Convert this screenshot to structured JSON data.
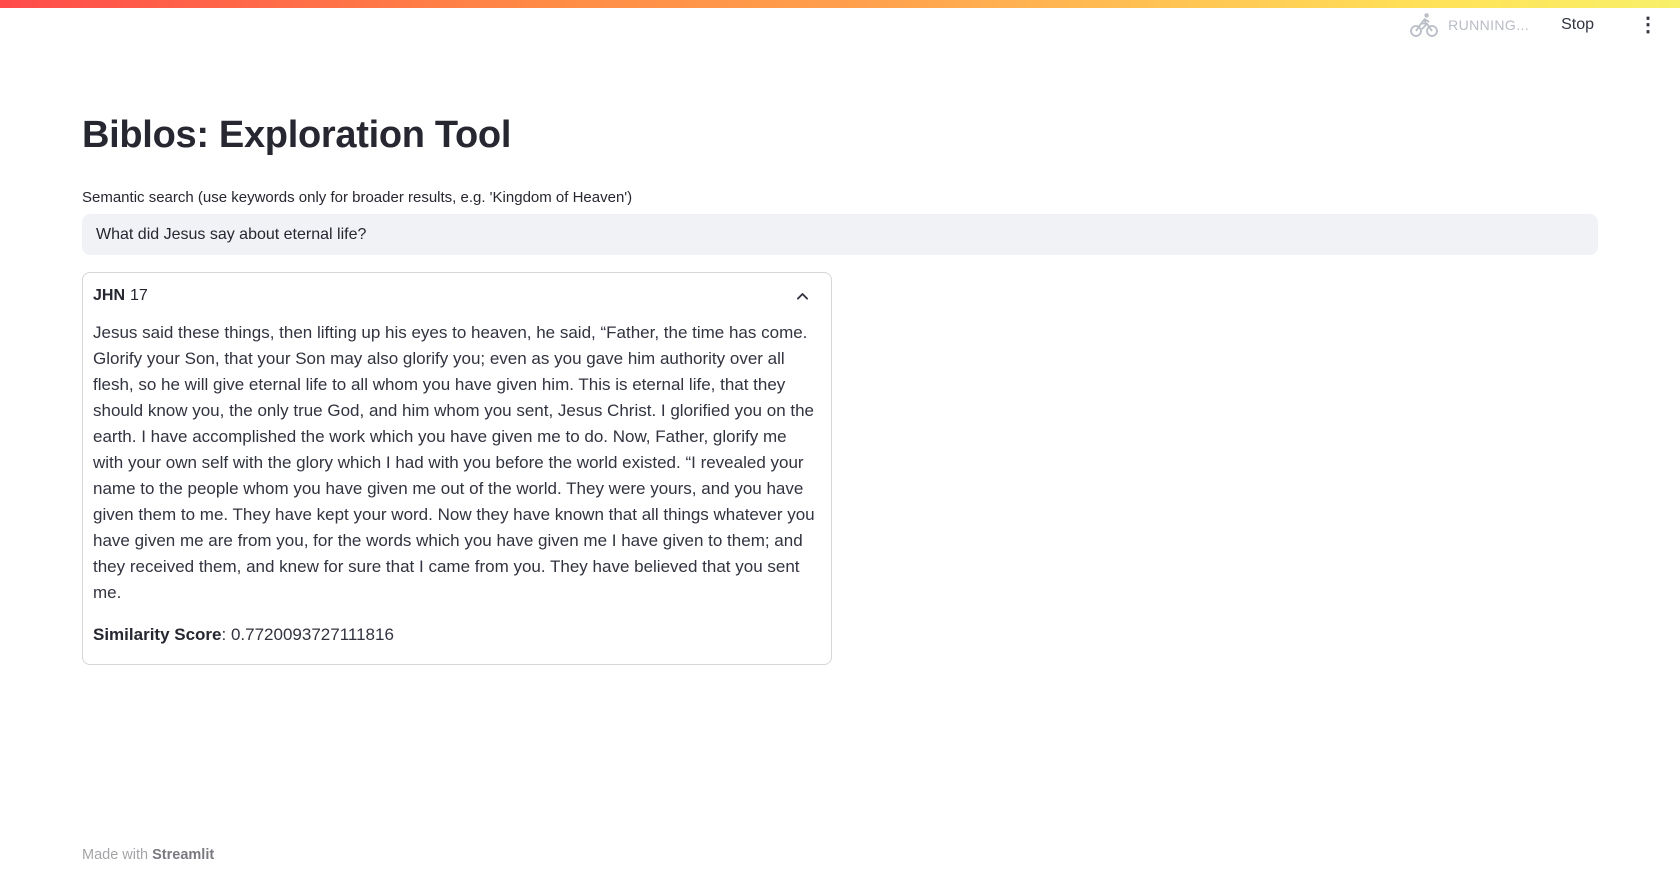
{
  "header": {
    "status_label": "RUNNING...",
    "stop_label": "Stop",
    "icons": {
      "running": "cyclist-running-indicator",
      "menu": "kebab-menu",
      "kebab_glyph": "⋮"
    }
  },
  "main": {
    "title": "Biblos: Exploration Tool",
    "search": {
      "label": "Semantic search (use keywords only for broader results, e.g. 'Kingdom of Heaven')",
      "value": "What did Jesus say about eternal life?"
    },
    "result": {
      "book": "JHN",
      "chapter": "17",
      "passage": "Jesus said these things, then lifting up his eyes to heaven, he said, “Father, the time has come. Glorify your Son, that your Son may also glorify you; even as you gave him authority over all flesh, so he will give eternal life to all whom you have given him. This is eternal life, that they should know you, the only true God, and him whom you sent, Jesus Christ. I glorified you on the earth. I have accomplished the work which you have given me to do. Now, Father, glorify me with your own self with the glory which I had with you before the world existed. “I revealed your name to the people whom you have given me out of the world. They were yours, and you have given them to me. They have kept your word. Now they have known that all things whatever you have given me are from you, for the words which you have given me I have given to them; and they received them, and knew for sure that I came from you. They have believed that you sent me.",
      "score_label": "Similarity Score",
      "score_separator": ": ",
      "score_value": "0.7720093727111816"
    }
  },
  "footer": {
    "made_with": "Made with ",
    "brand": "Streamlit"
  },
  "colors": {
    "decoration_gradient_start": "#ff4b4b",
    "decoration_gradient_mid": "#ffa14e",
    "decoration_gradient_end": "#f8f06a",
    "text_dark": "#262730",
    "body_text": "#31333f",
    "input_background": "#f0f2f6",
    "muted_status": "#b8bcc4",
    "card_border": "rgba(49,51,63,0.2)"
  }
}
